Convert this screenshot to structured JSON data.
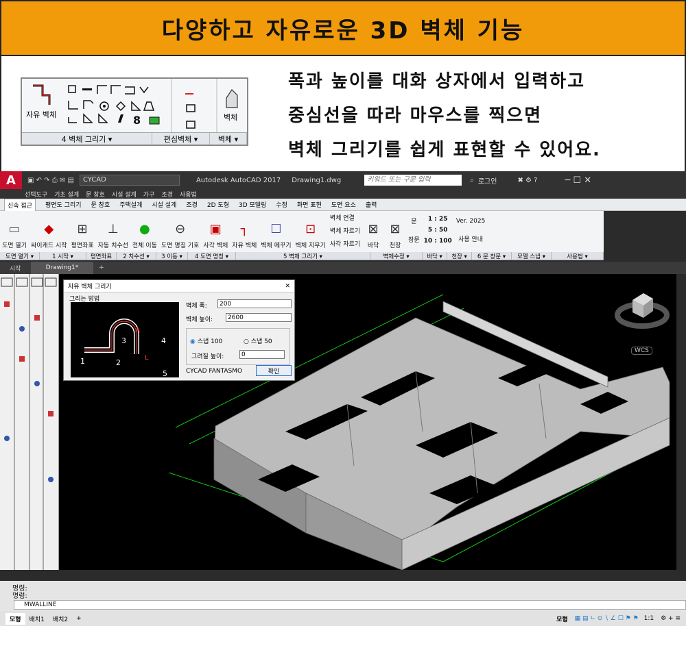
{
  "banner": {
    "title": "다양하고 자유로운 3D 벽체 기능"
  },
  "promo": {
    "lines": [
      "폭과 높이를 대화 상자에서 입력하고",
      "중심선을 따라 마우스를 찍으면",
      "벽체 그리기를 쉽게 표현할 수 있어요."
    ],
    "ribbon": {
      "free_wall": "자유 벽체",
      "wall": "벽체",
      "group_draw": "4 벽체 그리기 ▾",
      "group_offset": "편심벽체 ▾",
      "group_wall": "벽체 ▾"
    }
  },
  "app": {
    "title": "Autodesk AutoCAD 2017",
    "drawing": "Drawing1.dwg",
    "workspace": "CYCAD",
    "search_placeholder": "키워드 또는 구문 입력",
    "login": "로그인",
    "menu": [
      "선택도구",
      "기초 설계",
      "문 창호",
      "시설 설계",
      "가구",
      "조경",
      "사용법"
    ],
    "ribbon_tabs": [
      "신속 접근",
      "평면도 그리기",
      "문 창호",
      "주택설계",
      "시설 설계",
      "조경",
      "2D 도형",
      "3D 모델링",
      "수정",
      "화면 표현",
      "도면 요소",
      "출력"
    ],
    "tools": [
      "도면 열기",
      "싸이캐드 시작",
      "평면좌표",
      "자동 치수선",
      "전체 이동",
      "도면 명칭 기호",
      "사각 벽체",
      "자유 벽체",
      "벽체 메꾸기",
      "벽체 지우기",
      "바닥",
      "천장",
      "장문",
      "Ver. 2025",
      "사용 안내"
    ],
    "wall_edit": [
      "벽체 연결",
      "벽체 자르기",
      "사각 자르기"
    ],
    "door_label": "문",
    "scale_labels": [
      "1 : 25",
      "5 : 50",
      "10 : 100"
    ],
    "panel_groups": [
      "도면 열기 ▾",
      "1 시작 ▾",
      "평면좌표",
      "2 치수선 ▾",
      "3 이동 ▾",
      "4 도면 명칭 ▾",
      "5 벽체 그리기 ▾",
      "벽체수정 ▾",
      "바닥 ▾",
      "천장 ▾",
      "6 문 창문 ▾",
      "모델 스냅 ▾",
      "사용법 ▾"
    ],
    "file_tabs": [
      "시작",
      "Drawing1*"
    ],
    "viewcube_label": "WCS",
    "dialog": {
      "title": "자유 벽체 그리기",
      "group": "그리는 방법",
      "width_label": "벽체 폭:",
      "width_value": "200",
      "height_label": "벽체 높이:",
      "height_value": "2600",
      "snap100": "스냅 100",
      "snap50": "스냅 50",
      "base_label": "그려질 높이:",
      "base_value": "0",
      "footer": "CYCAD FANTASMO",
      "ok": "확인",
      "diagram_labels": [
        "1",
        "2",
        "3",
        "4",
        "5",
        "A",
        "L"
      ]
    },
    "command": {
      "line1": "명령:",
      "line2": "명령:",
      "input": "MWALLINE"
    },
    "layout_tabs": [
      "모형",
      "배치1",
      "배치2"
    ],
    "status_model": "모형",
    "status_scale": "1:1"
  },
  "colors": {
    "banner": "#f29b0a",
    "viewport": "#000000",
    "wall": "#b0b0b0",
    "dim": "#16c016"
  }
}
